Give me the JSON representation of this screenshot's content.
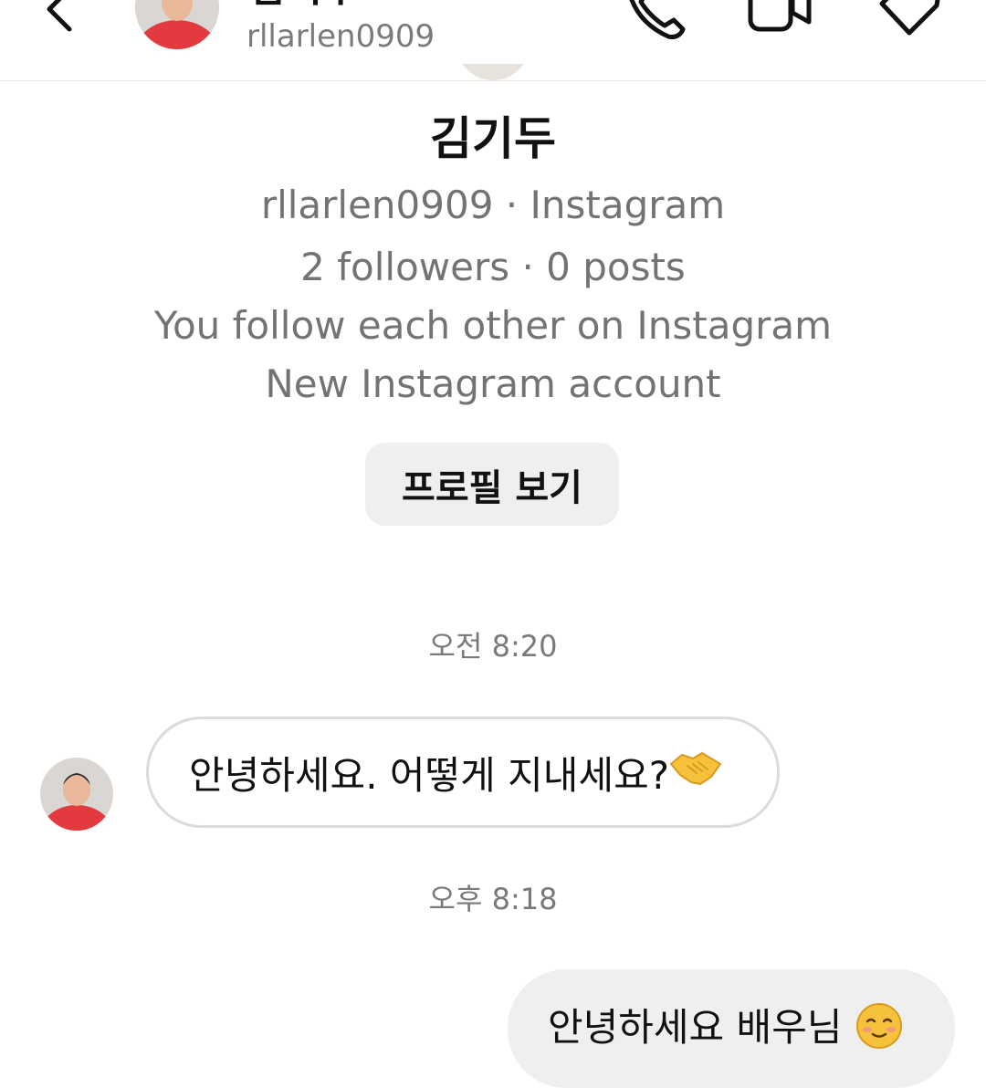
{
  "header": {
    "name": "김기두",
    "username": "rllarlen0909",
    "icons": {
      "back": "chevron-left-icon",
      "call": "phone-icon",
      "video": "video-camera-icon",
      "tag": "tag-icon"
    }
  },
  "profile": {
    "name": "김기두",
    "username_line": "rllarlen0909 · Instagram",
    "stats_line": "2 followers · 0 posts",
    "mutual_line": "You follow each other on Instagram",
    "account_line": "New Instagram account",
    "view_profile_label": "프로필 보기"
  },
  "messages": {
    "timestamp_1": "오전 8:20",
    "incoming_text": "안녕하세요. 어떻게 지내세요?",
    "incoming_emoji": "handshake-emoji",
    "timestamp_2": "오후 8:18",
    "outgoing_text": "안녕하세요 배우님",
    "outgoing_emoji": "smiling-blush-emoji"
  },
  "colors": {
    "secondary_text": "#737373",
    "button_bg": "#efefef",
    "bubble_border": "#dbdbdb",
    "outgoing_bubble_bg": "#efefef",
    "avatar_shirt": "#e23a3f"
  }
}
